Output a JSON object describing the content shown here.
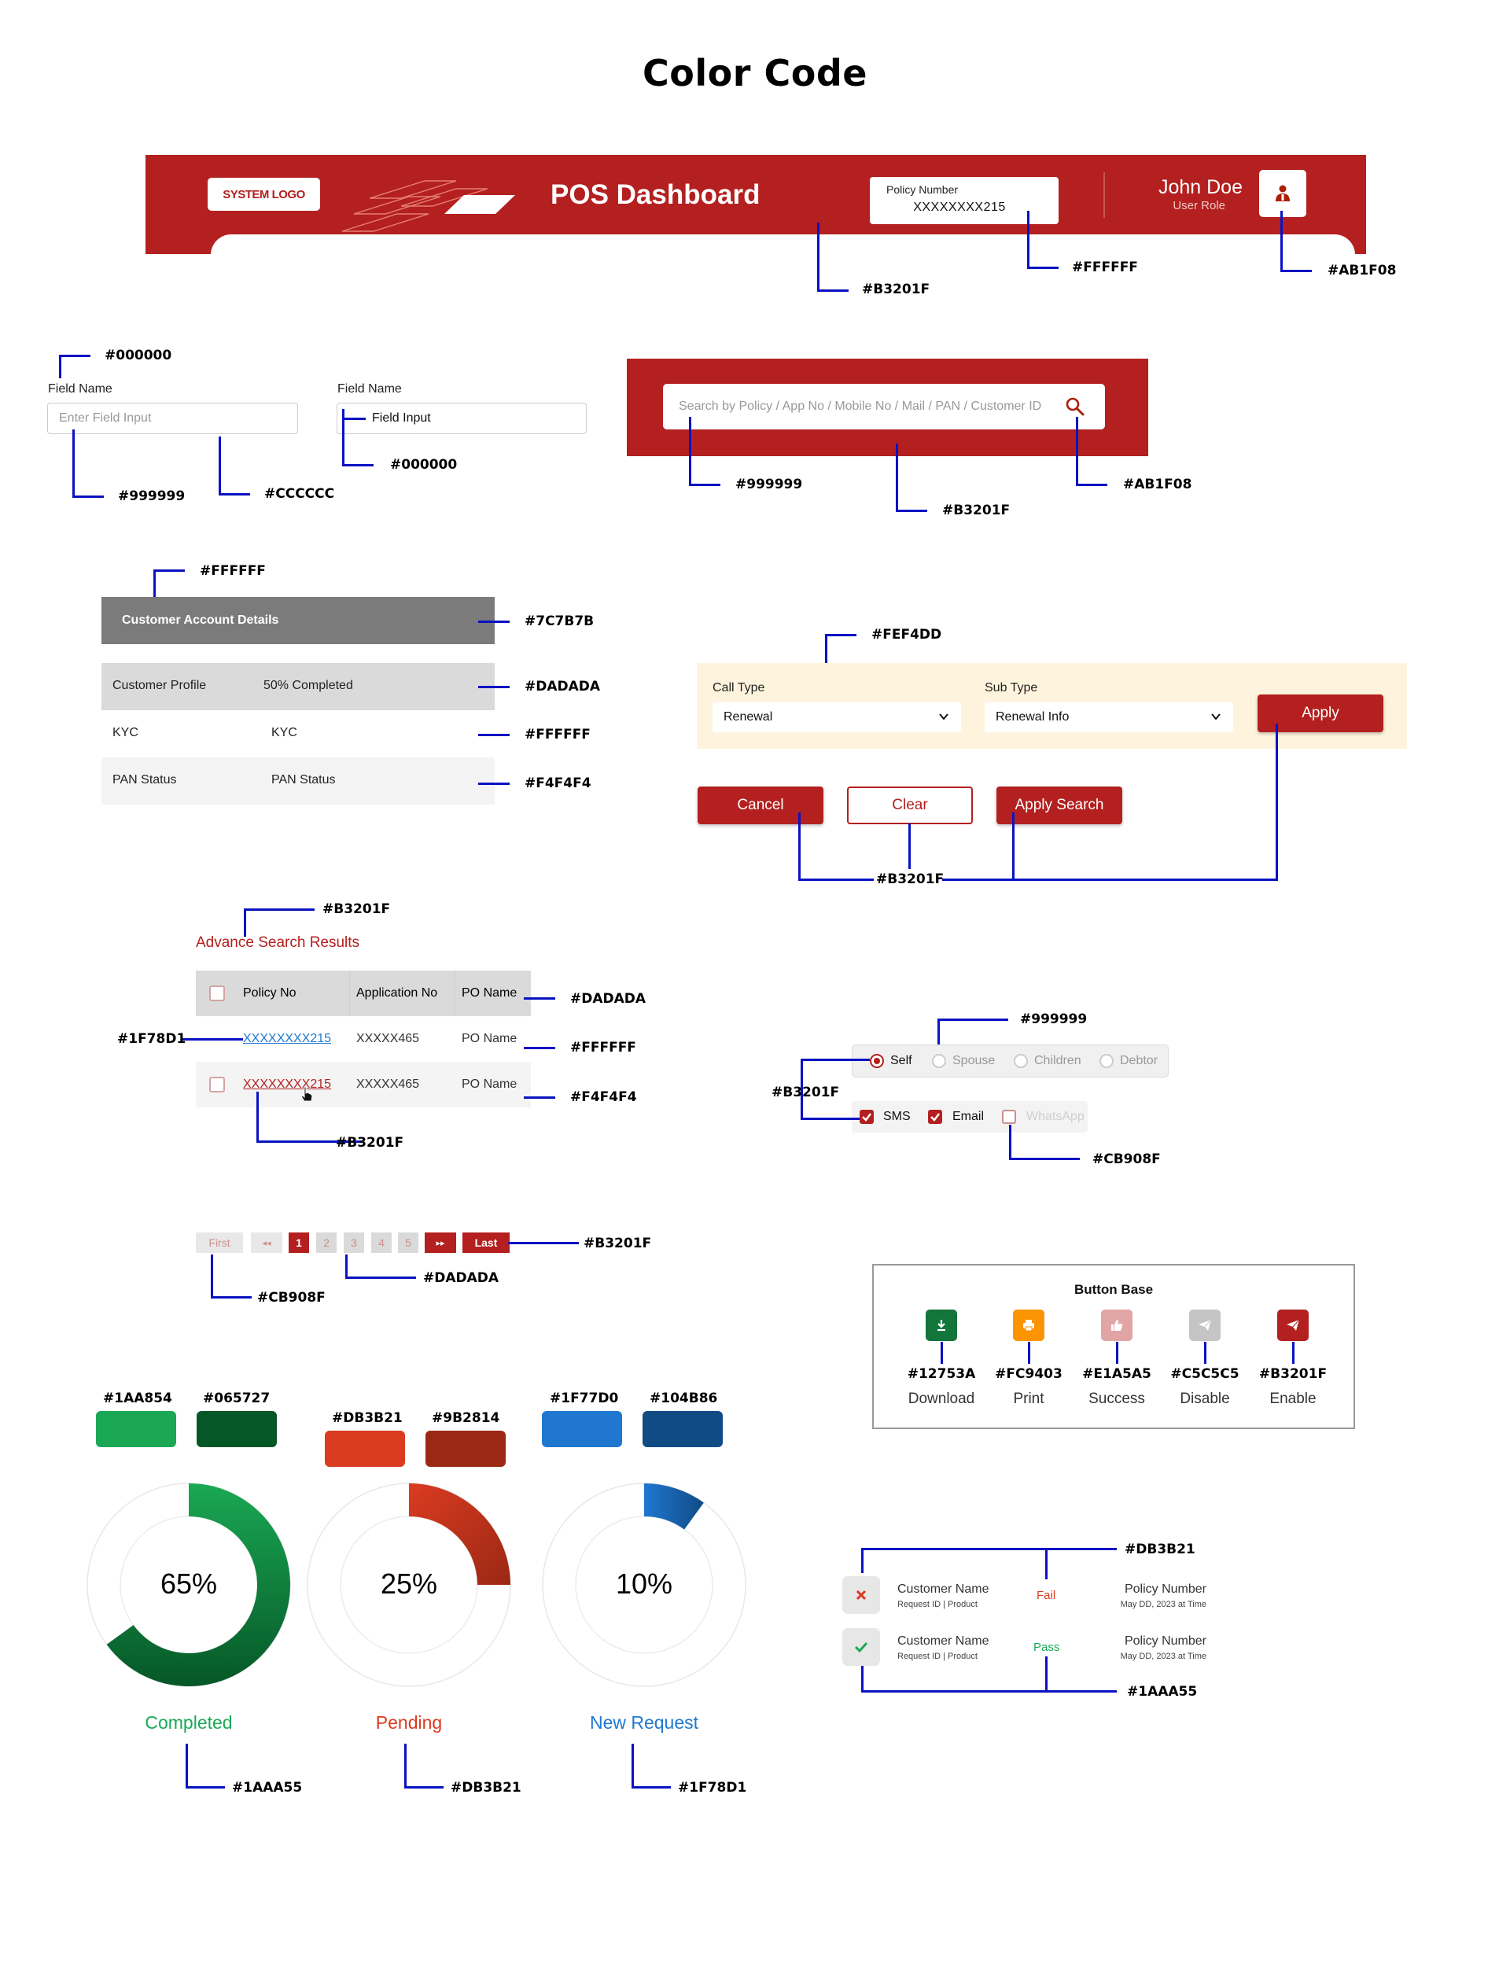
{
  "page_title": "Color Code",
  "header": {
    "logo": "SYSTEM LOGO",
    "title": "POS Dashboard",
    "policy_label": "Policy Number",
    "policy_value": "XXXXXXXX215",
    "user_name": "John Doe",
    "user_role": "User Role",
    "codes": {
      "bg": "#B3201F",
      "policy": "#FFFFFF",
      "avatar": "#AB1F08"
    }
  },
  "fields": {
    "label": "Field Name",
    "placeholder": "Enter Field Input",
    "value": "Field Input",
    "codes": {
      "label": "#000000",
      "placeholder": "#999999",
      "border": "#CCCCCC",
      "value": "#000000"
    }
  },
  "search": {
    "placeholder": "Search by Policy / App No / Mobile No / Mail / PAN / Customer ID",
    "codes": {
      "placeholder": "#999999",
      "bg": "#B3201F",
      "icon": "#AB1F08"
    }
  },
  "account": {
    "header": "Customer Account Details",
    "rows": [
      {
        "col1": "Customer Profile",
        "col2": "50% Completed",
        "code": "#DADADA"
      },
      {
        "col1": "KYC",
        "col2": "KYC",
        "code": "#FFFFFF"
      },
      {
        "col1": "PAN Status",
        "col2": "PAN Status",
        "code": "#F4F4F4"
      }
    ],
    "codes": {
      "header_text": "#FFFFFF",
      "header_bg": "#7C7B7B"
    }
  },
  "filter": {
    "code": "#FEF4DD",
    "call_type_label": "Call Type",
    "call_type_value": "Renewal",
    "sub_type_label": "Sub Type",
    "sub_type_value": "Renewal Info",
    "apply": "Apply",
    "cancel": "Cancel",
    "clear": "Clear",
    "apply_search": "Apply Search",
    "buttons_code": "#B3201F"
  },
  "results": {
    "title": "Advance Search Results",
    "title_code": "#B3201F",
    "columns": [
      "Policy No",
      "Application No",
      "PO Name"
    ],
    "rows": [
      {
        "policy": "XXXXXXXX215",
        "app": "XXXXX465",
        "po": "PO Name"
      },
      {
        "policy": "XXXXXXXX215",
        "app": "XXXXX465",
        "po": "PO Name"
      }
    ],
    "codes": {
      "header": "#DADADA",
      "row1": "#FFFFFF",
      "row2": "#F4F4F4",
      "link": "#1F78D1",
      "link_hover": "#B3201F"
    }
  },
  "options": {
    "radios": [
      "Self",
      "Spouse",
      "Children",
      "Debtor"
    ],
    "checks": [
      "SMS",
      "Email",
      "WhatsApp"
    ],
    "codes": {
      "inactive": "#999999",
      "active": "#B3201F",
      "disabled": "#CB908F"
    }
  },
  "pagination": {
    "first": "First",
    "prev": "◂◂",
    "pages": [
      "1",
      "2",
      "3",
      "4",
      "5"
    ],
    "next": "▸▸",
    "last": "Last",
    "codes": {
      "active": "#B3201F",
      "disabled": "#CB908F",
      "pages": "#DADADA"
    }
  },
  "button_base": {
    "title": "Button Base",
    "items": [
      {
        "code": "#12753A",
        "name": "Download",
        "icon": "download-icon"
      },
      {
        "code": "#FC9403",
        "name": "Print",
        "icon": "print-icon"
      },
      {
        "code": "#E1A5A5",
        "name": "Success",
        "icon": "thumbs-up-icon"
      },
      {
        "code": "#C5C5C5",
        "name": "Disable",
        "icon": "send-icon"
      },
      {
        "code": "#B3201F",
        "name": "Enable",
        "icon": "send-icon"
      }
    ]
  },
  "swatches": [
    {
      "code": "#1AA854"
    },
    {
      "code": "#065727"
    },
    {
      "code": "#DB3B21"
    },
    {
      "code": "#9B2814"
    },
    {
      "code": "#1F77D0"
    },
    {
      "code": "#104B86"
    }
  ],
  "donuts": [
    {
      "percent": 65,
      "label_text": "65%",
      "name": "Completed",
      "code": "#1AAA55"
    },
    {
      "percent": 25,
      "label_text": "25%",
      "name": "Pending",
      "code": "#DB3B21"
    },
    {
      "percent": 10,
      "label_text": "10%",
      "name": "New Request",
      "code": "#1F78D1"
    }
  ],
  "status": {
    "rows": [
      {
        "name": "Customer Name",
        "sub": "Request ID  |  Product",
        "result": "Fail",
        "policy": "Policy Number",
        "date": "May DD, 2023 at Time",
        "icon": "close-icon"
      },
      {
        "name": "Customer Name",
        "sub": "Request ID  |  Product",
        "result": "Pass",
        "policy": "Policy Number",
        "date": "May DD, 2023 at Time",
        "icon": "check-icon"
      }
    ],
    "codes": {
      "fail": "#DB3B21",
      "pass": "#1AAA55"
    }
  }
}
